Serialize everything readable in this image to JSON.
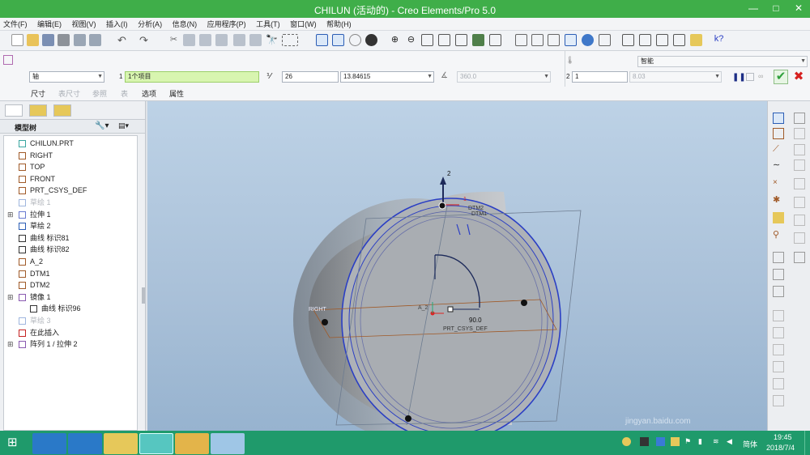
{
  "app": {
    "title": "CHILUN (活动的) - Creo Elements/Pro 5.0"
  },
  "window_controls": {
    "minimize": "—",
    "maximize": "□",
    "close": "✕"
  },
  "menu": [
    "文件(F)",
    "编辑(E)",
    "视图(V)",
    "插入(I)",
    "分析(A)",
    "信息(N)",
    "应用程序(P)",
    "工具(T)",
    "窗口(W)",
    "帮助(H)"
  ],
  "dashboard": {
    "type_select": "轴",
    "reference_count": "1",
    "reference_value": "1个项目",
    "pattern_count": "26",
    "increment_value": "13.84615",
    "angle_range": "360.0",
    "second_count_label": "2",
    "second_count": "1",
    "second_spacing": "8.03",
    "filter_select": "智能",
    "tabs": [
      "尺寸",
      "表尺寸",
      "参照",
      "表",
      "选项",
      "属性"
    ],
    "tab_enabled": [
      true,
      false,
      false,
      false,
      true,
      true
    ]
  },
  "model_tree": {
    "title": "模型树",
    "items": [
      {
        "label": "CHILUN.PRT",
        "suppressed": false,
        "icon": "part-icon",
        "expand": false
      },
      {
        "label": "RIGHT",
        "suppressed": false,
        "icon": "datum-plane-icon",
        "expand": false
      },
      {
        "label": "TOP",
        "suppressed": false,
        "icon": "datum-plane-icon",
        "expand": false
      },
      {
        "label": "FRONT",
        "suppressed": false,
        "icon": "datum-plane-icon",
        "expand": false
      },
      {
        "label": "PRT_CSYS_DEF",
        "suppressed": false,
        "icon": "csys-icon",
        "expand": false
      },
      {
        "label": "草绘 1",
        "suppressed": true,
        "icon": "sketch-icon",
        "expand": false
      },
      {
        "label": "拉伸 1",
        "suppressed": false,
        "icon": "extrude-icon",
        "expand": true
      },
      {
        "label": "草绘 2",
        "suppressed": false,
        "icon": "sketch-icon",
        "expand": false
      },
      {
        "label": "曲线 标识81",
        "suppressed": false,
        "icon": "curve-icon",
        "expand": false
      },
      {
        "label": "曲线 标识82",
        "suppressed": false,
        "icon": "curve-icon",
        "expand": false
      },
      {
        "label": "A_2",
        "suppressed": false,
        "icon": "axis-icon",
        "expand": false
      },
      {
        "label": "DTM1",
        "suppressed": false,
        "icon": "datum-plane-icon",
        "expand": false
      },
      {
        "label": "DTM2",
        "suppressed": false,
        "icon": "datum-plane-icon",
        "expand": false
      },
      {
        "label": "镜像 1",
        "suppressed": false,
        "icon": "mirror-icon",
        "expand": true
      },
      {
        "label": "曲线 标识96",
        "suppressed": false,
        "icon": "curve-icon",
        "expand": false,
        "indent": true
      },
      {
        "label": "草绘 3",
        "suppressed": true,
        "icon": "sketch-icon",
        "expand": false
      },
      {
        "label": "在此插入",
        "suppressed": false,
        "icon": "insert-here-icon",
        "expand": false
      },
      {
        "label": "阵列 1 / 拉伸 2",
        "suppressed": false,
        "icon": "pattern-icon",
        "expand": true
      }
    ]
  },
  "graphics": {
    "labels": {
      "axis_z": "2",
      "axis_x": "1",
      "dtm2": "DTM2",
      "dtm1": "DTM1",
      "right": "RIGHT",
      "csys": "PRT_CSYS_DEF",
      "a2": "A_2",
      "angle": "90.0",
      "watermark": "jingyan.baidu.com"
    }
  },
  "taskbar": {
    "time": "19:45",
    "date": "2018/7/4",
    "ime": "简体"
  },
  "colors": {
    "titlebar": "#3fae49",
    "taskbar": "#1f9a6b",
    "accept": "#2ea03b",
    "cancel": "#d62020",
    "model_edge": "#2b3fc4"
  }
}
